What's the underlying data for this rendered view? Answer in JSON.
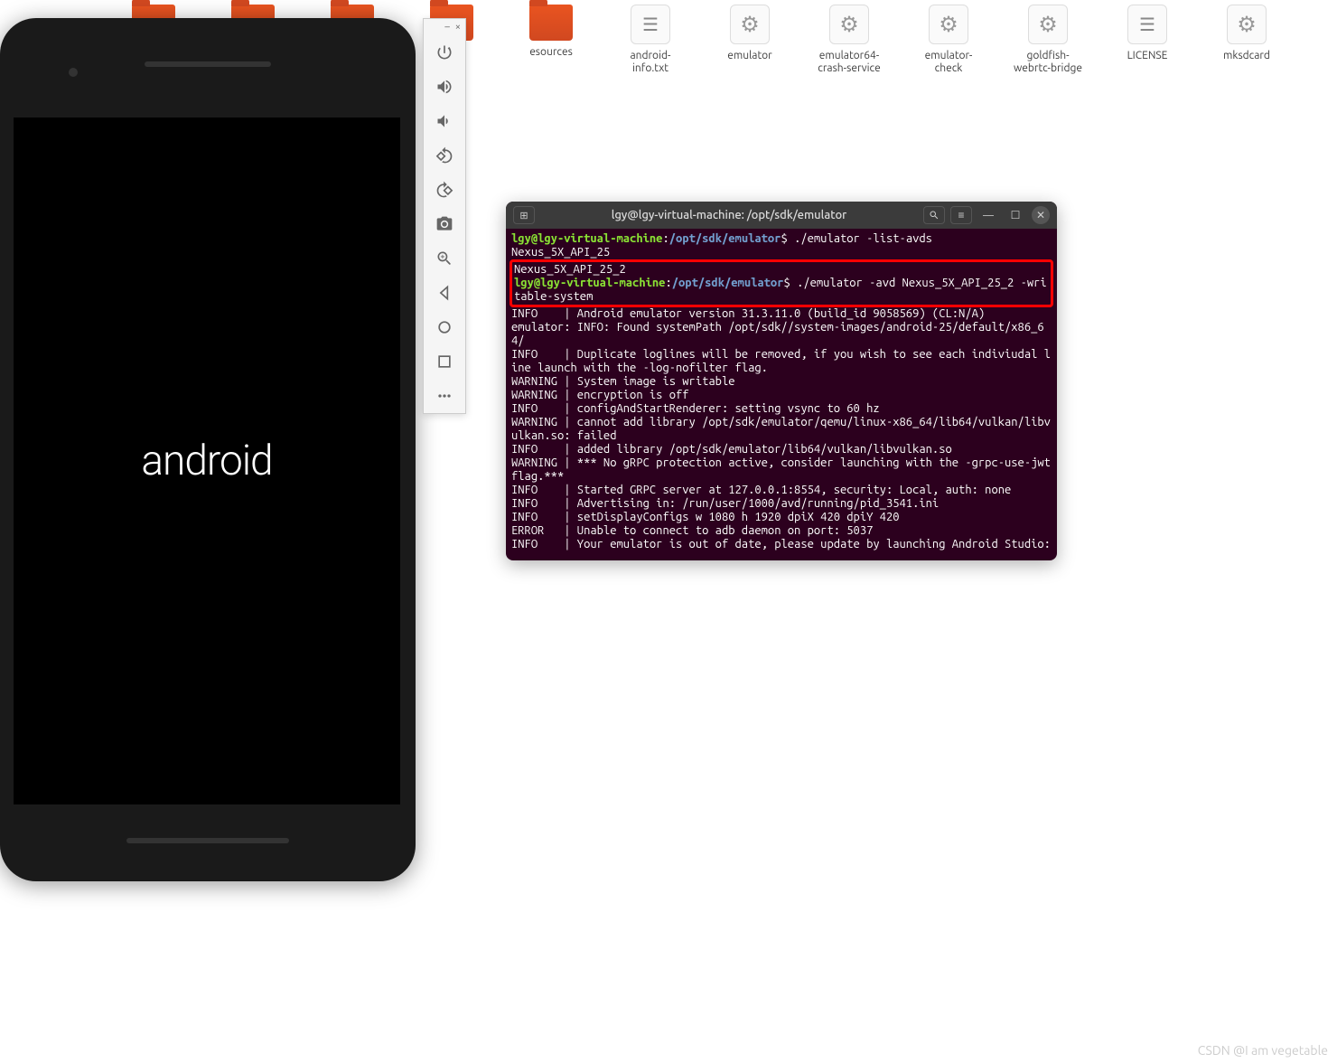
{
  "desktop": {
    "icons": [
      {
        "type": "folder",
        "label": ""
      },
      {
        "type": "folder",
        "label": ""
      },
      {
        "type": "folder",
        "label": ""
      },
      {
        "type": "folder",
        "label": ""
      },
      {
        "type": "folder",
        "label": "esources"
      },
      {
        "type": "file-lines",
        "label": "android-info.txt"
      },
      {
        "type": "file-gear",
        "label": "emulator"
      },
      {
        "type": "file-gear",
        "label": "emulator64-crash-service"
      },
      {
        "type": "file-gear",
        "label": "emulator-check"
      },
      {
        "type": "file-gear",
        "label": "goldfish-webrtc-bridge"
      },
      {
        "type": "file-lines",
        "label": "LICENSE"
      },
      {
        "type": "file-gear",
        "label": "mksdcard"
      }
    ]
  },
  "phone": {
    "logo_text": "android"
  },
  "emu_toolbar": {
    "minimize": "–",
    "close": "×",
    "buttons": [
      "power",
      "vol-up",
      "vol-down",
      "rotate-left",
      "rotate-right",
      "camera",
      "zoom",
      "back",
      "home",
      "overview",
      "more"
    ]
  },
  "terminal": {
    "title": "lgy@lgy-virtual-machine: /opt/sdk/emulator",
    "prompt_user": "lgy@lgy-virtual-machine",
    "prompt_path": "/opt/sdk/emulator",
    "cmd1": "./emulator -list-avds",
    "avd1": "Nexus_5X_API_25",
    "avd2": "Nexus_5X_API_25_2",
    "cmd2": "./emulator -avd Nexus_5X_API_25_2 -writable-system",
    "output": "INFO    | Android emulator version 31.3.11.0 (build_id 9058569) (CL:N/A)\nemulator: INFO: Found systemPath /opt/sdk//system-images/android-25/default/x86_64/\nINFO    | Duplicate loglines will be removed, if you wish to see each indiviudal line launch with the -log-nofilter flag.\nWARNING | System image is writable\nWARNING | encryption is off\nINFO    | configAndStartRenderer: setting vsync to 60 hz\nWARNING | cannot add library /opt/sdk/emulator/qemu/linux-x86_64/lib64/vulkan/libvulkan.so: failed\nINFO    | added library /opt/sdk/emulator/lib64/vulkan/libvulkan.so\nWARNING | *** No gRPC protection active, consider launching with the -grpc-use-jwt flag.***\nINFO    | Started GRPC server at 127.0.0.1:8554, security: Local, auth: none\nINFO    | Advertising in: /run/user/1000/avd/running/pid_3541.ini\nINFO    | setDisplayConfigs w 1080 h 1920 dpiX 420 dpiY 420\nERROR   | Unable to connect to adb daemon on port: 5037\nINFO    | Your emulator is out of date, please update by launching Android Studio:"
  },
  "watermark": "CSDN @I am vegetable"
}
